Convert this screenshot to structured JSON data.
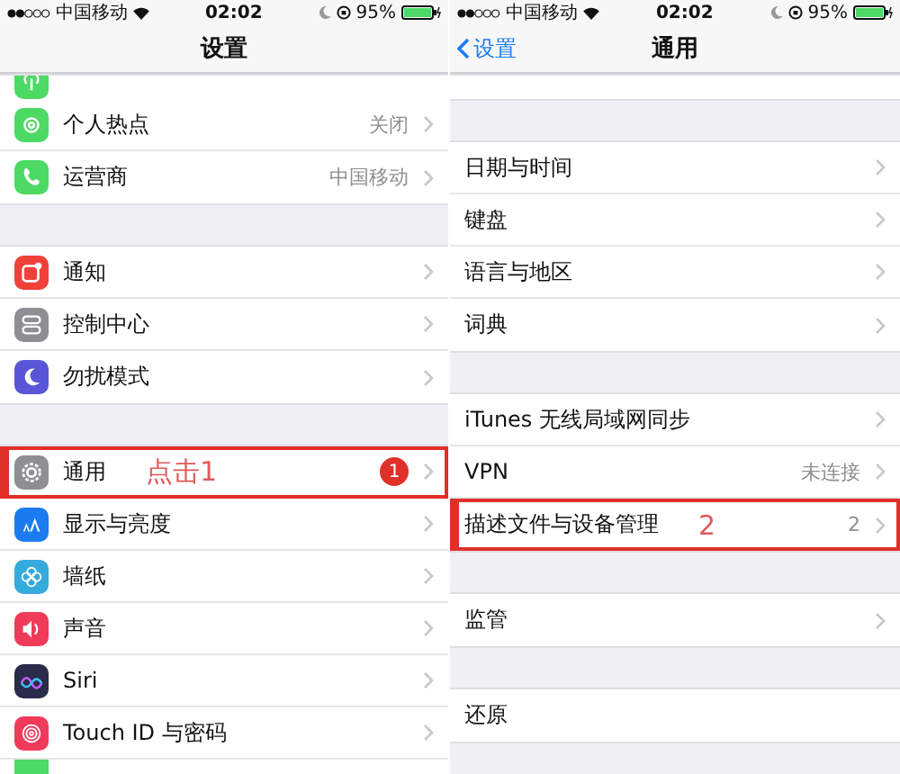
{
  "screens": [
    {
      "status_bar": {
        "carrier": "中国移动",
        "time": "02:02",
        "battery": "95%"
      },
      "nav": {
        "title": "设置"
      },
      "sections": [
        {
          "rows": [
            {
              "kind": "partial",
              "icon": {
                "kind": "antenna",
                "color": "#4cd964"
              }
            },
            {
              "kind": "row",
              "label": "个人热点",
              "value": "关闭",
              "icon": {
                "kind": "hotspot",
                "color": "#4cd964"
              },
              "highlighted": false
            },
            {
              "kind": "row",
              "label": "运营商",
              "value": "中国移动",
              "icon": {
                "kind": "phone",
                "color": "#4cd964"
              },
              "highlighted": false
            }
          ]
        },
        {
          "rows": [
            {
              "kind": "row",
              "label": "通知",
              "icon": {
                "kind": "notification",
                "color": "#f0403a"
              },
              "highlighted": false
            },
            {
              "kind": "row",
              "label": "控制中心",
              "icon": {
                "kind": "toggles",
                "color": "#8e8e93"
              },
              "highlighted": false
            },
            {
              "kind": "row",
              "label": "勿扰模式",
              "icon": {
                "kind": "moon",
                "color": "#5856d6"
              },
              "highlighted": false
            }
          ]
        },
        {
          "rows": [
            {
              "kind": "row",
              "label": "通用",
              "icon": {
                "kind": "gear",
                "color": "#8e8e93"
              },
              "badge": "1",
              "annotation": "点击1",
              "highlighted": true
            },
            {
              "kind": "row",
              "label": "显示与亮度",
              "icon": {
                "kind": "letters",
                "color": "#1a7cf0"
              },
              "highlighted": false
            },
            {
              "kind": "row",
              "label": "墙纸",
              "icon": {
                "kind": "flower",
                "color": "#35aadc"
              },
              "highlighted": false
            },
            {
              "kind": "row",
              "label": "声音",
              "icon": {
                "kind": "speaker",
                "color": "#f03a5a"
              },
              "highlighted": false
            },
            {
              "kind": "row",
              "label": "Siri",
              "icon": {
                "kind": "wave",
                "color": "#2a2a4a"
              },
              "highlighted": false
            },
            {
              "kind": "row",
              "label": "Touch ID 与密码",
              "icon": {
                "kind": "fingerprint",
                "color": "#f03a5a"
              },
              "highlighted": false
            },
            {
              "kind": "partial",
              "icon": {
                "kind": "plain",
                "color": "#4cd964"
              }
            }
          ]
        }
      ]
    },
    {
      "status_bar": {
        "carrier": "中国移动",
        "time": "02:02",
        "battery": "95%"
      },
      "nav": {
        "back": "设置",
        "title": "通用"
      },
      "sections": [
        {
          "rows": [
            {
              "kind": "partial"
            }
          ]
        },
        {
          "rows": [
            {
              "kind": "row",
              "label": "日期与时间",
              "highlighted": false
            },
            {
              "kind": "row",
              "label": "键盘",
              "highlighted": false
            },
            {
              "kind": "row",
              "label": "语言与地区",
              "highlighted": false
            },
            {
              "kind": "row",
              "label": "词典",
              "highlighted": false
            }
          ]
        },
        {
          "rows": [
            {
              "kind": "row",
              "label": "iTunes 无线局域网同步",
              "highlighted": false
            },
            {
              "kind": "row",
              "label": "VPN",
              "value": "未连接",
              "highlighted": false
            },
            {
              "kind": "row",
              "label": "描述文件与设备管理",
              "value": "2",
              "annotation": "2",
              "highlighted": true
            }
          ]
        },
        {
          "rows": [
            {
              "kind": "row",
              "label": "监管",
              "highlighted": false
            }
          ]
        },
        {
          "rows": [
            {
              "kind": "row",
              "label": "还原",
              "chevron": false,
              "highlighted": false
            }
          ]
        }
      ]
    }
  ]
}
